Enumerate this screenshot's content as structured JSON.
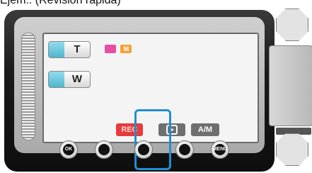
{
  "caption": {
    "text": "Ejem.: (Revisión rápida)"
  },
  "lcd": {
    "zoom_tele_label": "T",
    "zoom_wide_label": "W",
    "mode_icons": [
      "video-icon",
      "manual-icon"
    ],
    "manual_icon_text": "M"
  },
  "softkeys": {
    "rec_label": "REC",
    "playback_icon": "quick-review-icon",
    "mode_label": "A/M"
  },
  "hardware_buttons": {
    "ok_label": "OK",
    "menu_label": "MENU"
  },
  "highlight": {
    "color": "#1f8fd1"
  }
}
